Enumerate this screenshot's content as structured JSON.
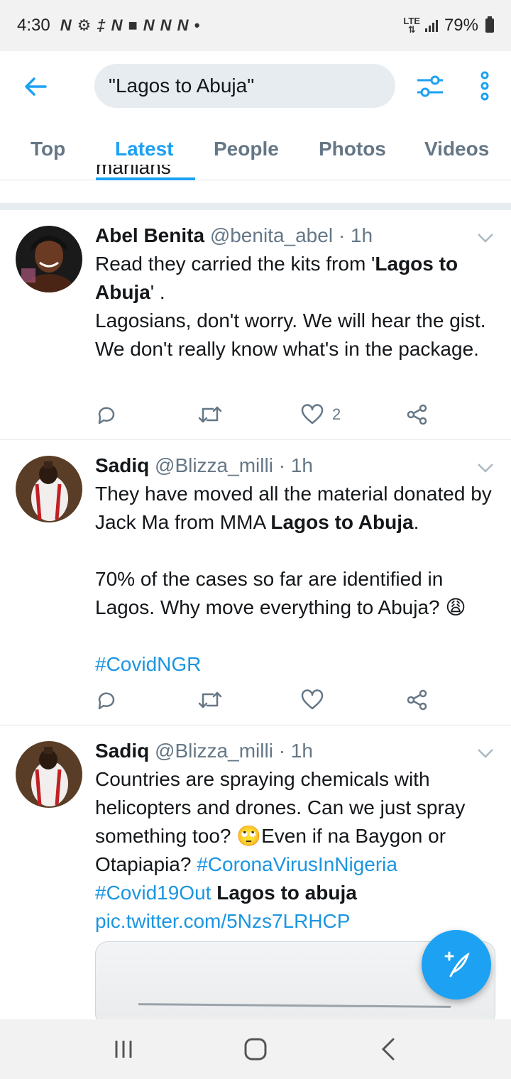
{
  "status_bar": {
    "time": "4:30",
    "notification_glyphs": [
      "N",
      "⚙",
      "‡",
      "N",
      "■",
      "N",
      "N",
      "N",
      "•"
    ],
    "network": "LTE",
    "battery": "79%"
  },
  "search": {
    "query": "\"Lagos to Abuja\""
  },
  "tabs": [
    {
      "label": "Top"
    },
    {
      "label": "Latest"
    },
    {
      "label": "People"
    },
    {
      "label": "Photos"
    },
    {
      "label": "Videos"
    }
  ],
  "active_tab": "Latest",
  "cutoff_text": "mariians",
  "tweets": [
    {
      "name": "Abel Benita",
      "handle": "@benita_abel",
      "time": "· 1h",
      "text_parts": [
        {
          "t": "Read they carried the kits from '",
          "style": "normal"
        },
        {
          "t": "Lagos to Abuja",
          "style": "bold"
        },
        {
          "t": "' .\nLagosians, don't worry. We will hear the gist.  We don't really know what's in the package.",
          "style": "normal"
        }
      ],
      "like_count": "2"
    },
    {
      "name": "Sadiq",
      "handle": "@Blizza_milli",
      "time": "· 1h",
      "text_parts": [
        {
          "t": "They have moved all the material donated by Jack Ma from MMA ",
          "style": "normal"
        },
        {
          "t": "Lagos to Abuja",
          "style": "bold"
        },
        {
          "t": ".\n\n70% of the cases so far are identified in Lagos. Why move everything to Abuja? 😩\n\n",
          "style": "normal"
        },
        {
          "t": "#CovidNGR",
          "style": "tag"
        }
      ],
      "like_count": ""
    },
    {
      "name": "Sadiq",
      "handle": "@Blizza_milli",
      "time": "· 1h",
      "text_parts": [
        {
          "t": "Countries are spraying chemicals with helicopters and drones. Can we just spray something too? 🙄Even if na Baygon or Otapiapia? ",
          "style": "normal"
        },
        {
          "t": "#CoronaVirusInNigeria",
          "style": "tag"
        },
        {
          "t": "\n",
          "style": "normal"
        },
        {
          "t": "#Covid19Out",
          "style": "tag"
        },
        {
          "t": " ",
          "style": "normal"
        },
        {
          "t": "Lagos to abuja",
          "style": "bold"
        },
        {
          "t": "\n",
          "style": "normal"
        },
        {
          "t": "pic.twitter.com/5Nzs7LRHCP",
          "style": "tag"
        }
      ],
      "like_count": ""
    }
  ],
  "colors": {
    "accent": "#1da1f2",
    "secondary_text": "#657786",
    "divider": "#e1e8ed"
  }
}
